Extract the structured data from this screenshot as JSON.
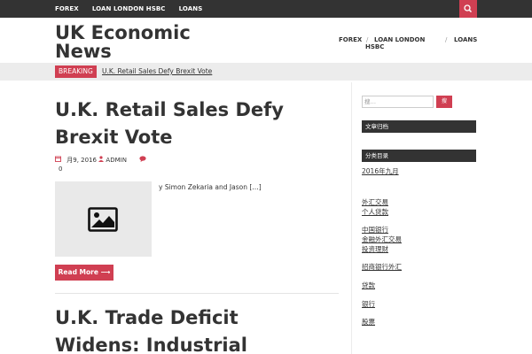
{
  "topbar": {
    "nav": [
      "FOREX",
      "LOAN LONDON HSBC",
      "LOANS"
    ],
    "search_icon": "search-icon"
  },
  "site": {
    "brand_line1": "UK Economic",
    "brand_line2": "News"
  },
  "mainnav": {
    "items": [
      "FOREX",
      "LOAN LONDON",
      "HSBC",
      "LOANS"
    ],
    "separator": "/"
  },
  "breaking": {
    "label": "BREAKING",
    "headline": "U.K. Retail Sales Defy Brexit Vote"
  },
  "posts": [
    {
      "title_line1": "U.K. Retail Sales Defy",
      "title_line2": "Brexit Vote",
      "date": "月9, 2016",
      "author": "ADMIN",
      "comments": "0",
      "excerpt": "y Simon Zekaria and Jason […]",
      "read_more": "Read More ⟶"
    },
    {
      "title_line1": "U.K. Trade Deficit",
      "title_line2": "Widens: Industrial"
    }
  ],
  "sidebar": {
    "search_placeholder": "搜…",
    "search_button": "搜",
    "widget1_title": "文章归档",
    "archive_link": "2016年九月",
    "widget2_title": "分类目录",
    "links": [
      "外汇交易",
      "个人贷款",
      "中国银行",
      "金融外汇交易",
      "投资理财",
      "招商银行外汇",
      "贷款",
      "银行",
      "股票"
    ]
  },
  "colors": {
    "accent": "#d03f52",
    "dark": "#333333",
    "band": "#ececec"
  }
}
